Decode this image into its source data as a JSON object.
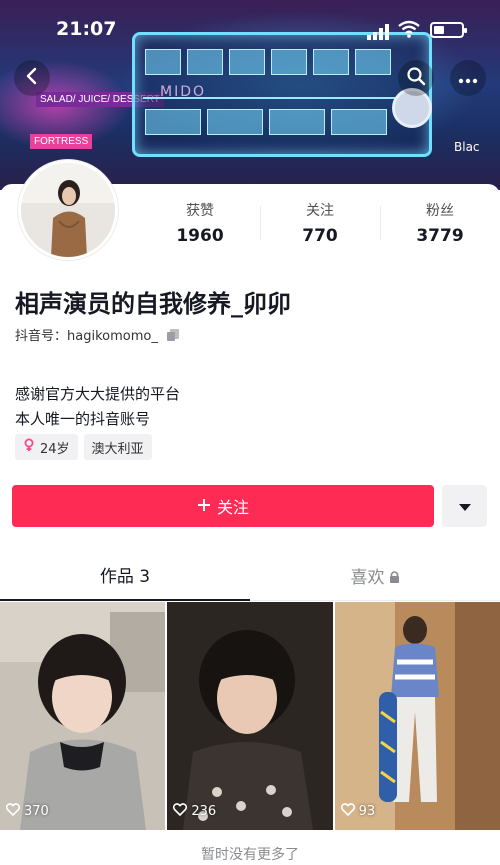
{
  "status_bar": {
    "time": "21:07"
  },
  "banner": {
    "sign_1": "SALAD/ JUICE/ DESSERT",
    "sign_2": "FORTRESS",
    "mido": "MIDO",
    "corner_text": "Blac"
  },
  "profile": {
    "nickname": "相声演员的自我修养_卯卯",
    "douyin_id": "抖音号：hagikomomo_",
    "bio_lines": [
      "感谢官方大大提供的平台",
      "本人唯一的抖音账号"
    ],
    "tags": {
      "age": "24岁",
      "location": "澳大利亚"
    },
    "stats": [
      {
        "label": "获赞",
        "value": "1960"
      },
      {
        "label": "关注",
        "value": "770"
      },
      {
        "label": "粉丝",
        "value": "3779"
      }
    ]
  },
  "actions": {
    "follow_label": "关注"
  },
  "tabs": {
    "works": "作品 3",
    "likes": "喜欢"
  },
  "videos": [
    {
      "likes": "370"
    },
    {
      "likes": "236"
    },
    {
      "likes": "93"
    }
  ],
  "footer": {
    "no_more": "暂时没有更多了"
  },
  "colors": {
    "accent": "#fe2c55",
    "text": "#161823",
    "muted": "#8a8b91",
    "gender": "#f14b8a"
  }
}
